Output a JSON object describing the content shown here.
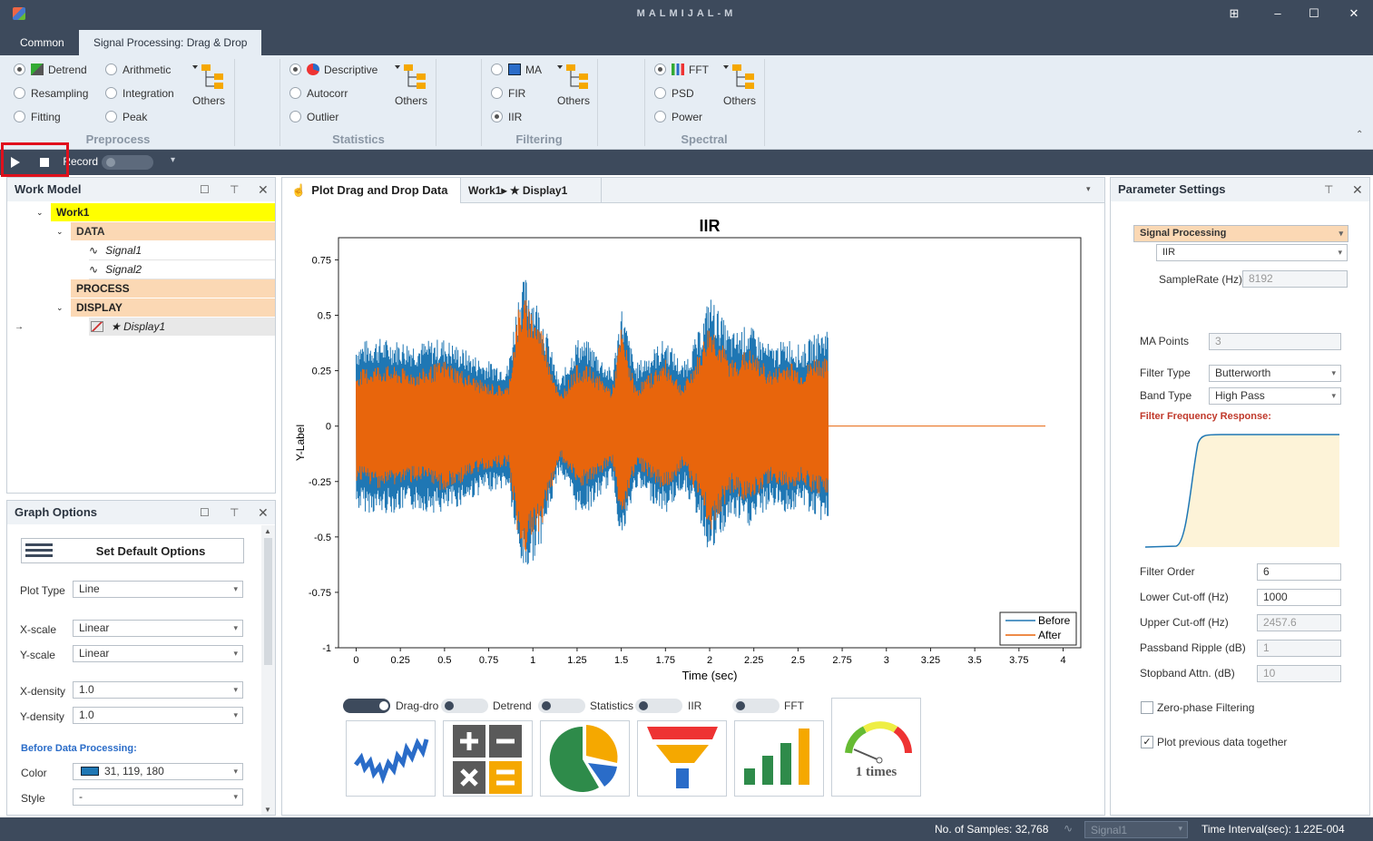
{
  "app": {
    "title": "MALMIJAL-M"
  },
  "tabs": [
    "Common",
    "Signal Processing: Drag & Drop"
  ],
  "ribbon": {
    "preprocess": {
      "label": "Preprocess",
      "col1": [
        "Detrend",
        "Resampling",
        "Fitting"
      ],
      "col2": [
        "Arithmetic",
        "Integration",
        "Peak"
      ],
      "others": "Others"
    },
    "statistics": {
      "label": "Statistics",
      "items": [
        "Descriptive",
        "Autocorr",
        "Outlier"
      ],
      "others": "Others"
    },
    "filtering": {
      "label": "Filtering",
      "items": [
        "MA",
        "FIR",
        "IIR"
      ],
      "others": "Others"
    },
    "spectral": {
      "label": "Spectral",
      "items": [
        "FFT",
        "PSD",
        "Power"
      ],
      "others": "Others"
    }
  },
  "toolbar": {
    "record_label": "Record"
  },
  "work_model": {
    "title": "Work Model",
    "root": "Work1",
    "data": "DATA",
    "signals": [
      "Signal1",
      "Signal2"
    ],
    "process": "PROCESS",
    "display": "DISPLAY",
    "display_item": "★ Display1"
  },
  "graph_options": {
    "title": "Graph Options",
    "default_btn": "Set Default Options",
    "plot_type_label": "Plot Type",
    "plot_type": "Line",
    "xscale_label": "X-scale",
    "xscale": "Linear",
    "yscale_label": "Y-scale",
    "yscale": "Linear",
    "xdensity_label": "X-density",
    "xdensity": "1.0",
    "ydensity_label": "Y-density",
    "ydensity": "1.0",
    "before_label": "Before Data Processing:",
    "color_label": "Color",
    "color_value": "31, 119, 180",
    "color_hex": "#1f77b4",
    "style_label": "Style",
    "style_value": "-"
  },
  "center": {
    "tab1": "Plot Drag and Drop Data",
    "tab2": "Work1▸ ★ Display1",
    "toggles": [
      "Drag-dro",
      "Detrend",
      "Statistics",
      "IIR",
      "FFT"
    ],
    "gauge_text": "1 times"
  },
  "chart_data": {
    "type": "line",
    "title": "IIR",
    "xlabel": "Time (sec)",
    "ylabel": "Y-Label",
    "xlim": [
      -0.1,
      4.1
    ],
    "ylim": [
      -1,
      0.85
    ],
    "xticks": [
      "0",
      "0.25",
      "0.5",
      "0.75",
      "1",
      "1.25",
      "1.5",
      "1.75",
      "2",
      "2.25",
      "2.5",
      "2.75",
      "3",
      "3.25",
      "3.5",
      "3.75",
      "4"
    ],
    "yticks": [
      "0.75",
      "0.5",
      "0.25",
      "0",
      "-0.25",
      "-0.5",
      "-0.75",
      "-1"
    ],
    "series": [
      {
        "name": "Before",
        "color": "#1f77b4",
        "x": [
          0,
          0.12,
          0.35,
          0.5,
          0.72,
          0.86,
          0.92,
          0.96,
          1.05,
          1.15,
          1.25,
          1.32,
          1.45,
          1.5,
          1.58,
          1.75,
          1.85,
          1.95,
          2.0,
          2.12,
          2.22,
          2.35,
          2.45,
          2.52,
          2.6,
          2.67
        ],
        "amp": [
          0.38,
          0.4,
          0.38,
          0.4,
          0.3,
          0.28,
          0.62,
          0.68,
          0.52,
          0.2,
          0.4,
          0.38,
          0.25,
          0.55,
          0.28,
          0.4,
          0.28,
          0.45,
          0.6,
          0.42,
          0.46,
          0.36,
          0.4,
          0.36,
          0.42,
          0.45
        ]
      },
      {
        "name": "After",
        "color": "#e8650c",
        "x": [
          0,
          0.12,
          0.35,
          0.5,
          0.72,
          0.86,
          0.92,
          0.96,
          1.05,
          1.15,
          1.25,
          1.32,
          1.45,
          1.5,
          1.58,
          1.75,
          1.85,
          1.95,
          2.0,
          2.12,
          2.22,
          2.35,
          2.45,
          2.52,
          2.6,
          2.67
        ],
        "amp": [
          0.25,
          0.28,
          0.25,
          0.3,
          0.2,
          0.18,
          0.55,
          0.58,
          0.45,
          0.14,
          0.28,
          0.27,
          0.17,
          0.45,
          0.18,
          0.3,
          0.18,
          0.35,
          0.48,
          0.3,
          0.35,
          0.25,
          0.3,
          0.25,
          0.32,
          0.3
        ]
      }
    ],
    "flat_until": 3.9,
    "legend": "bottom-right"
  },
  "params": {
    "title": "Parameter Settings",
    "sp_label": "Signal Processing",
    "method": "IIR",
    "samplerate_label": "SampleRate (Hz)",
    "samplerate": "8192",
    "ma_label": "MA Points",
    "ma": "3",
    "filtertype_label": "Filter Type",
    "filtertype": "Butterworth",
    "bandtype_label": "Band Type",
    "bandtype": "High Pass",
    "response_label": "Filter Frequency Response:",
    "order_label": "Filter Order",
    "order": "6",
    "lower_label": "Lower Cut-off (Hz)",
    "lower": "1000",
    "upper_label": "Upper Cut-off (Hz)",
    "upper": "2457.6",
    "ripple_label": "Passband Ripple (dB)",
    "ripple": "1",
    "stop_label": "Stopband Attn. (dB)",
    "stop": "10",
    "zerophase_label": "Zero-phase Filtering",
    "plotprev_label": "Plot previous data together"
  },
  "status": {
    "samples": "No. of Samples: 32,768",
    "signal": "Signal1",
    "interval": "Time Interval(sec): 1.22E-004"
  }
}
